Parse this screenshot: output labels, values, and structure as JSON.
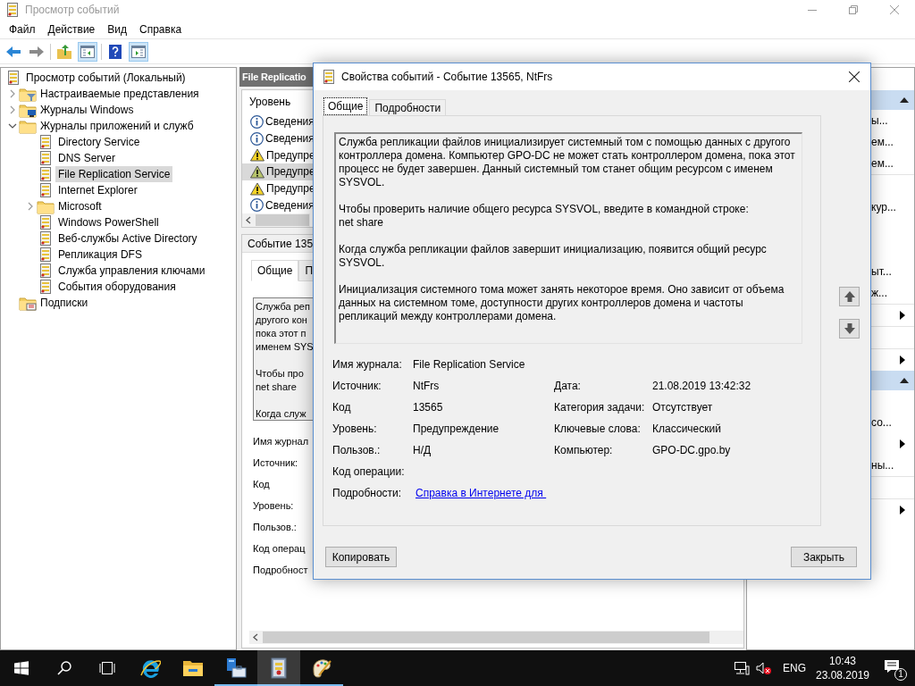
{
  "window": {
    "title": "Просмотр событий"
  },
  "menu": [
    "Файл",
    "Действие",
    "Вид",
    "Справка"
  ],
  "tree": [
    {
      "label": "Просмотр событий (Локальный)",
      "kind": "root",
      "selected": false,
      "children": [
        {
          "label": "Настраиваемые представления",
          "kind": "folder-filter",
          "expanded": false,
          "selected": false
        },
        {
          "label": "Журналы Windows",
          "kind": "folder-windows",
          "expanded": false,
          "selected": false
        },
        {
          "label": "Журналы приложений и служб",
          "kind": "folder",
          "expanded": true,
          "selected": false,
          "children": [
            {
              "label": "Directory Service",
              "kind": "log",
              "selected": false
            },
            {
              "label": "DNS Server",
              "kind": "log",
              "selected": false
            },
            {
              "label": "File Replication Service",
              "kind": "log",
              "selected": true
            },
            {
              "label": "Internet Explorer",
              "kind": "log",
              "selected": false
            },
            {
              "label": "Microsoft",
              "kind": "folder",
              "expanded": false,
              "selected": false
            },
            {
              "label": "Windows PowerShell",
              "kind": "log",
              "selected": false
            },
            {
              "label": "Веб-службы Active Directory",
              "kind": "log",
              "selected": false
            },
            {
              "label": "Репликация DFS",
              "kind": "log",
              "selected": false
            },
            {
              "label": "Служба управления ключами",
              "kind": "log",
              "selected": false
            },
            {
              "label": "События оборудования",
              "kind": "log",
              "selected": false
            }
          ]
        },
        {
          "label": "Подписки",
          "kind": "subscriptions",
          "selected": false
        }
      ]
    }
  ],
  "middle": {
    "title": "File Replicatio",
    "column": "Уровень",
    "rows": [
      {
        "kind": "info",
        "label": "Сведения",
        "selected": false
      },
      {
        "kind": "info",
        "label": "Сведения",
        "selected": false
      },
      {
        "kind": "warning",
        "label": "Предупре",
        "selected": false
      },
      {
        "kind": "warning",
        "label": "Предупре",
        "selected": true
      },
      {
        "kind": "warning",
        "label": "Предупре",
        "selected": false
      },
      {
        "kind": "info",
        "label": "Сведения",
        "selected": false
      }
    ],
    "event_title": "Событие 135",
    "tabs": [
      {
        "label": "Общие",
        "selected": true
      },
      {
        "label": "П",
        "selected": false
      }
    ],
    "description": [
      [
        "Служба реп",
        "другого кон",
        "пока этот п",
        "именем SYS"
      ],
      [
        "Чтобы про",
        "net share"
      ],
      [
        "Когда служ"
      ]
    ],
    "labels": [
      "Имя журнал",
      "Источник:",
      "Код",
      "Уровень:",
      "Пользов.:",
      "Код операц",
      "Подробност"
    ]
  },
  "actions": [
    {
      "kind": "header"
    },
    {
      "kind": "action",
      "text": "ы..."
    },
    {
      "kind": "action",
      "text": "ем..."
    },
    {
      "kind": "action",
      "text": "ем..."
    },
    {
      "kind": "separator"
    },
    {
      "kind": "spacer"
    },
    {
      "kind": "action",
      "text": "кур..."
    },
    {
      "kind": "spacer"
    },
    {
      "kind": "spacer"
    },
    {
      "kind": "action",
      "text": "ыт..."
    },
    {
      "kind": "action",
      "text": "ж..."
    },
    {
      "kind": "separator"
    },
    {
      "kind": "submenu"
    },
    {
      "kind": "separator"
    },
    {
      "kind": "spacer"
    },
    {
      "kind": "separator"
    },
    {
      "kind": "submenu"
    },
    {
      "kind": "header"
    },
    {
      "kind": "spacer"
    },
    {
      "kind": "action",
      "text": "со..."
    },
    {
      "kind": "submenu"
    },
    {
      "kind": "action",
      "text": "ны..."
    },
    {
      "kind": "separator"
    },
    {
      "kind": "spacer"
    },
    {
      "kind": "separator"
    },
    {
      "kind": "submenu"
    }
  ],
  "dialog": {
    "title": "Свойства событий - Событие 13565, NtFrs",
    "tabs": [
      {
        "label": "Общие",
        "selected": true
      },
      {
        "label": "Подробности",
        "selected": false
      }
    ],
    "description": [
      "Служба репликации файлов инициализирует системный том с помощью данных с другого контроллера домена. Компьютер GPO-DC не может стать контроллером домена, пока этот процесс не будет завершен. Данный системный том станет общим ресурсом с именем SYSVOL.",
      "Чтобы проверить наличие общего ресурса SYSVOL, введите в командной строке:\nnet share",
      "Когда служба репликации файлов завершит инициализацию, появится общий ресурс SYSVOL.",
      "Инициализация системного тома может занять некоторое время. Оно зависит от объема данных на системном томе, доступности других контроллеров домена и частоты репликаций между контроллерами домена."
    ],
    "fields": [
      {
        "left": {
          "label": "Имя журнала:",
          "value": "File Replication Service",
          "kind": "text"
        }
      },
      {
        "left": {
          "label": "Источник:",
          "value": "NtFrs",
          "kind": "text"
        },
        "right": {
          "label": "Дата:",
          "value": "21.08.2019 13:42:32"
        }
      },
      {
        "left": {
          "label": "Код",
          "value": "13565",
          "kind": "text"
        },
        "right": {
          "label": "Категория задачи:",
          "value": "Отсутствует"
        }
      },
      {
        "left": {
          "label": "Уровень:",
          "value": "Предупреждение",
          "kind": "text"
        },
        "right": {
          "label": "Ключевые слова:",
          "value": "Классический"
        }
      },
      {
        "left": {
          "label": "Пользов.:",
          "value": "Н/Д",
          "kind": "text"
        },
        "right": {
          "label": "Компьютер:",
          "value": "GPO-DC.gpo.by"
        }
      },
      {
        "left": {
          "label": "Код операции:"
        }
      },
      {
        "left": {
          "label": "Подробности:",
          "value": "Справка в Интернете для ",
          "kind": "link"
        }
      }
    ],
    "buttons": [
      "Копировать",
      "Закрыть"
    ]
  },
  "taskbar": {
    "apps": [
      {
        "kind": "browser",
        "running": false,
        "active": false
      },
      {
        "kind": "folder",
        "running": false,
        "active": false
      },
      {
        "kind": "server",
        "running": true,
        "active": false
      },
      {
        "kind": "log",
        "running": true,
        "active": true
      },
      {
        "kind": "paint",
        "running": true,
        "active": false
      }
    ],
    "language": "ENG",
    "time": "10:43",
    "date": "23.08.2019",
    "notifications": "1",
    "volume_muted": true
  }
}
